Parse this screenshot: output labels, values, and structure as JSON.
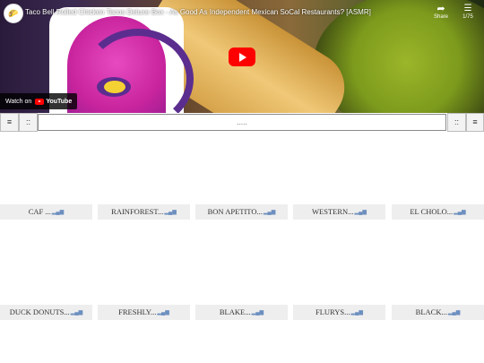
{
  "video": {
    "title": "Taco Bell Rolled Chicken Tacos Deluxe Box - As Good As Independent Mexican SoCal Restaurants? [ASMR]",
    "share_label": "Share",
    "playlist_counter": "1/75",
    "watch_on": "Watch on",
    "youtube_label": "YouTube",
    "accent_color": "#ff0000"
  },
  "toolbar": {
    "left_menu_glyph": "≡",
    "left_grid_glyph": "::",
    "search_value": ".....",
    "right_grid_glyph": "::",
    "right_menu_glyph": "≡"
  },
  "grid": {
    "signal_icon": "signal-bars-icon",
    "rows": [
      [
        {
          "label": "CAF ..."
        },
        {
          "label": "RAINFOREST..."
        },
        {
          "label": "BON APETITO..."
        },
        {
          "label": "WESTERN..."
        },
        {
          "label": "EL CHOLO..."
        }
      ],
      [
        {
          "label": "DUCK DONUTS..."
        },
        {
          "label": "FRESHLY..."
        },
        {
          "label": "BLAKE..."
        },
        {
          "label": "FLURYS..."
        },
        {
          "label": "BLACK..."
        }
      ]
    ]
  }
}
